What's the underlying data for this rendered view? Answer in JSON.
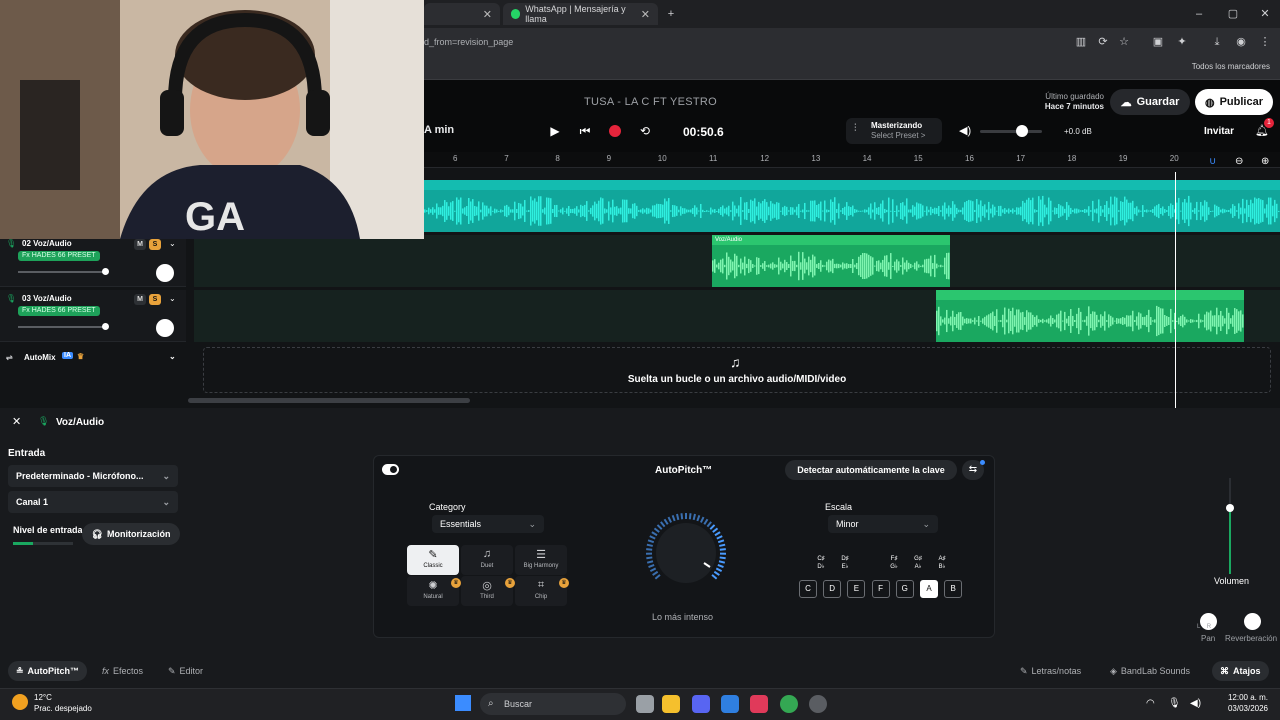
{
  "browser": {
    "tabs": [
      {
        "label": ""
      },
      {
        "label": "WhatsApp | Mensajería y llama"
      }
    ],
    "url": "d_from=revision_page",
    "bookmarks_label": "Todos los marcadores"
  },
  "header": {
    "song_title": "TUSA - LA C FT YESTRO",
    "saved_line1": "Último guardado",
    "saved_line2": "Hace 7 minutos",
    "save_label": "Guardar",
    "publish_label": "Publicar",
    "invite_label": "Invitar",
    "notifications": "1",
    "min_label": "A min"
  },
  "transport": {
    "time": "00:50.6",
    "master_title": "Masterizando",
    "master_preset": "Select Preset >",
    "master_db": "+0.0 dB",
    "volume_level": 0.62
  },
  "ruler": {
    "ticks": [
      "6",
      "7",
      "8",
      "9",
      "10",
      "11",
      "12",
      "13",
      "14",
      "15",
      "16",
      "17",
      "18",
      "19",
      "20"
    ]
  },
  "tracks": [
    {
      "number": "02",
      "name": "02  Voz/Audio",
      "fx": "Fx HADES 66 PRESET",
      "m": "M",
      "s": "S",
      "clip_label": "Voz/Audio"
    },
    {
      "number": "03",
      "name": "03  Voz/Audio",
      "fx": "Fx HADES 66 PRESET",
      "m": "M",
      "s": "S",
      "clip_label": ""
    }
  ],
  "automix": {
    "label": "AutoMix",
    "badge": "IA"
  },
  "dropzone": {
    "text": "Suelta un bucle o un archivo audio/MIDI/video"
  },
  "panel": {
    "title": "Voz/Audio",
    "entrada_label": "Entrada",
    "input_device": "Predeterminado - Micrófono...",
    "channel": "Canal 1",
    "level_label": "Nivel de entrada",
    "monitor_label": "Monitorización",
    "input_level": 0.33
  },
  "autopitch": {
    "title": "AutoPitch™",
    "detect_label": "Detectar automáticamente la clave",
    "category_label": "Category",
    "category_value": "Essentials",
    "scale_label": "Escala",
    "scale_value": "Minor",
    "knob_label": "Lo más intenso",
    "presets": [
      {
        "name": "Classic",
        "icon": "✎",
        "selected": true,
        "locked": false
      },
      {
        "name": "Duet",
        "icon": "♫",
        "selected": false,
        "locked": false
      },
      {
        "name": "Big Harmony",
        "icon": "☰",
        "selected": false,
        "locked": false
      },
      {
        "name": "Natural",
        "icon": "✺",
        "selected": false,
        "locked": true
      },
      {
        "name": "Third",
        "icon": "◎",
        "selected": false,
        "locked": true
      },
      {
        "name": "Chip",
        "icon": "⌗",
        "selected": false,
        "locked": true
      }
    ],
    "white_keys": [
      "C",
      "D",
      "E",
      "F",
      "G",
      "A",
      "B"
    ],
    "selected_key": "A",
    "black_keys": [
      "C♯\nD♭",
      "D♯\nE♭",
      "F♯\nG♭",
      "G♯\nA♭",
      "A♯\nB♭"
    ]
  },
  "mixer": {
    "volume_label": "Volumen",
    "pan_label": "Pan",
    "reverb_label": "Reverberación",
    "pan_lr": "L    R",
    "volume_level": 0.7
  },
  "bottom_tabs": {
    "autopitch": "AutoPitch™",
    "efectos": "Efectos",
    "editor": "Editor",
    "letras": "Letras/notas",
    "sounds": "BandLab Sounds",
    "atajos": "Atajos"
  },
  "taskbar": {
    "temp": "12°C",
    "weather": "Prac. despejado",
    "search": "Buscar",
    "time": "12:00 a. m.",
    "date": "03/03/2026"
  },
  "colors": {
    "accent_teal": "#14bcb0",
    "clip_green": "#1aa860",
    "solo_orange": "#e8a23b",
    "record_red": "#e5243b"
  }
}
